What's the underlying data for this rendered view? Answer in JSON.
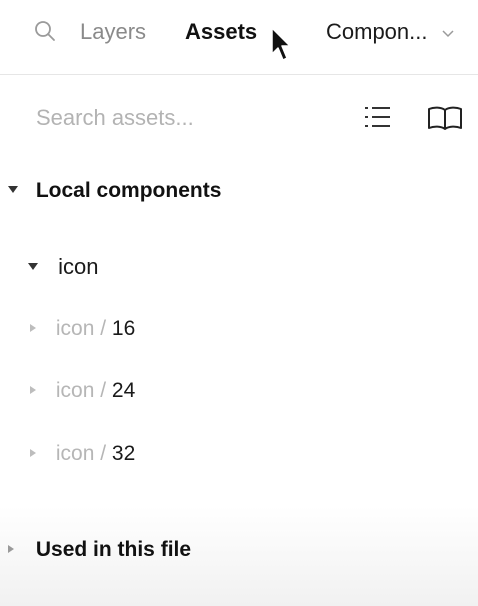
{
  "topbar": {
    "tabs": [
      {
        "label": "Layers",
        "active": false
      },
      {
        "label": "Assets",
        "active": true
      }
    ],
    "page_select": {
      "value": "Compon..."
    },
    "icons": {
      "search": "search-icon",
      "dropdown": "chevron-down-icon"
    }
  },
  "search": {
    "placeholder": "Search assets...",
    "value": "",
    "icons": {
      "list_view": "list-view-icon",
      "library": "book-open-icon"
    }
  },
  "local_components": {
    "title": "Local components",
    "expanded": true,
    "group": {
      "label": "icon",
      "expanded": true,
      "items": [
        {
          "prefix": "icon /",
          "size": "16"
        },
        {
          "prefix": "icon /",
          "size": "24"
        },
        {
          "prefix": "icon /",
          "size": "32"
        }
      ]
    }
  },
  "used_in_file": {
    "title": "Used in this file",
    "expanded": false
  },
  "colors": {
    "text": "#1a1a1a",
    "muted": "#8a8a8a",
    "faint": "#b6b6b6",
    "divider": "#e6e6e6"
  }
}
